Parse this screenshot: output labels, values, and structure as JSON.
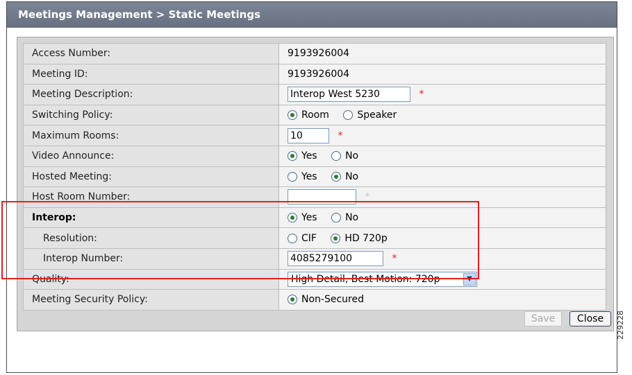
{
  "window": {
    "breadcrumb": "Meetings Management > Static Meetings"
  },
  "form": {
    "access_number": {
      "label": "Access Number:",
      "value": "9193926004"
    },
    "meeting_id": {
      "label": "Meeting ID:",
      "value": "9193926004"
    },
    "meeting_description": {
      "label": "Meeting Description:",
      "value": "Interop West 5230"
    },
    "switching_policy": {
      "label": "Switching Policy:",
      "options": [
        "Room",
        "Speaker"
      ],
      "selected": "Room"
    },
    "maximum_rooms": {
      "label": "Maximum Rooms:",
      "value": "10"
    },
    "video_announce": {
      "label": "Video Announce:",
      "options": [
        "Yes",
        "No"
      ],
      "selected": "Yes"
    },
    "hosted_meeting": {
      "label": "Hosted Meeting:",
      "options": [
        "Yes",
        "No"
      ],
      "selected": "No"
    },
    "host_room_number": {
      "label": "Host Room Number:",
      "value": ""
    },
    "interop": {
      "label": "Interop:",
      "options": [
        "Yes",
        "No"
      ],
      "selected": "Yes"
    },
    "resolution": {
      "label": "Resolution:",
      "options": [
        "CIF",
        "HD 720p"
      ],
      "selected": "HD 720p"
    },
    "interop_number": {
      "label": "Interop Number:",
      "value": "4085279100"
    },
    "quality": {
      "label": "Quality:",
      "value": "High Detail, Best Motion: 720p"
    },
    "meeting_security_policy": {
      "label": "Meeting Security Policy:",
      "options": [
        "Non-Secured"
      ],
      "selected": "Non-Secured"
    },
    "required_marker": "*"
  },
  "buttons": {
    "save": "Save",
    "close": "Close"
  },
  "figure_number": "229228",
  "colors": {
    "titlebar": "#6f7889",
    "required": "#e02020",
    "highlight": "#e01e1e"
  }
}
